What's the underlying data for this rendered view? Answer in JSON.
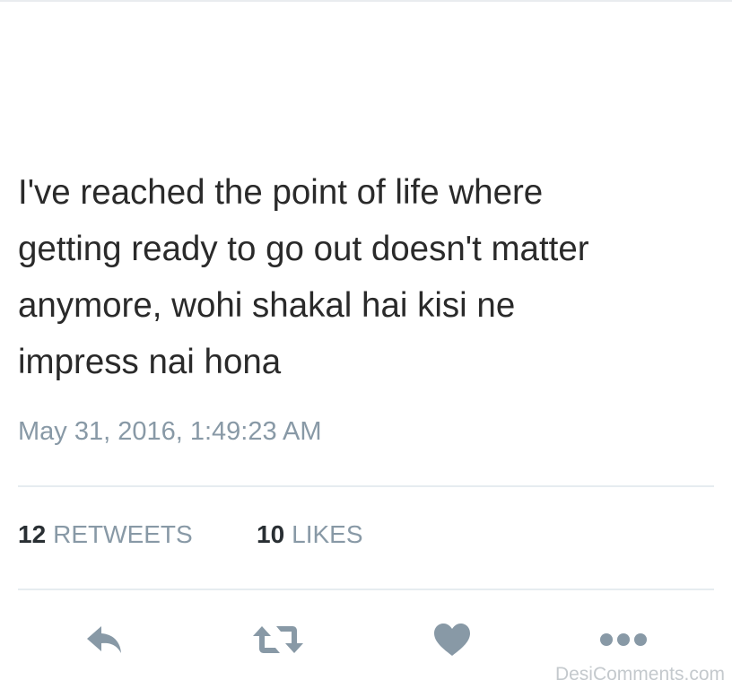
{
  "tweet": {
    "lines": [
      "I've reached the point of life where",
      "getting ready to go out doesn't matter",
      "anymore, wohi shakal hai kisi ne",
      "impress nai hona"
    ],
    "timestamp": "May 31, 2016, 1:49:23 AM"
  },
  "stats": {
    "retweets": {
      "count": "12",
      "label": "RETWEETS"
    },
    "likes": {
      "count": "10",
      "label": "LIKES"
    }
  },
  "actions": {
    "reply_icon": "reply-icon",
    "retweet_icon": "retweet-icon",
    "like_icon": "heart-icon",
    "more_icon": "more-icon",
    "icon_color": "#8899a6"
  },
  "watermark": "DesiComments.com"
}
